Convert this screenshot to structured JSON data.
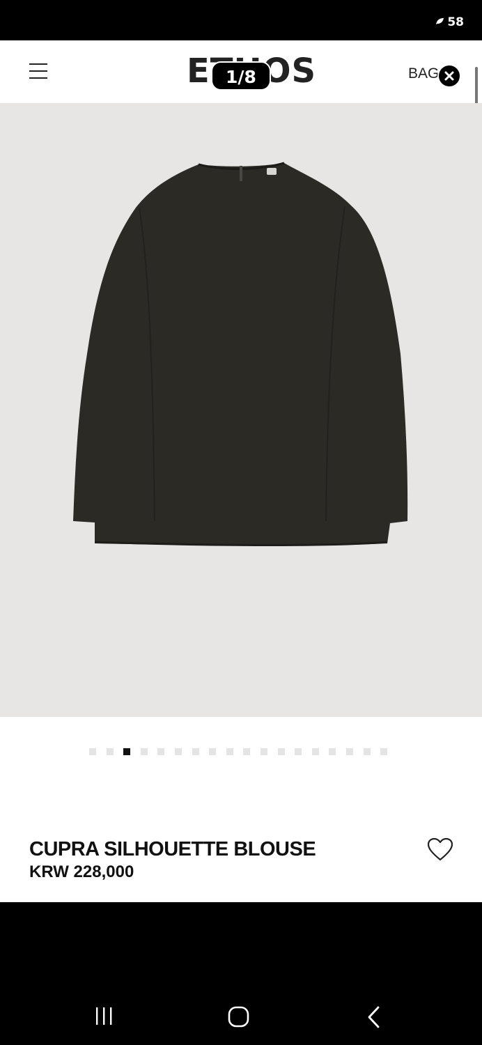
{
  "status_bar": {
    "battery": "58"
  },
  "header": {
    "logo": "ETHOS",
    "image_counter": "1/8",
    "bag_label": "BAG("
  },
  "gallery": {
    "total_dots": 18,
    "active_dot": 3
  },
  "product": {
    "name": "CUPRA SILHOUETTE BLOUSE",
    "price": "KRW 228,000"
  },
  "colors": {
    "image_background": "#e8e6e4",
    "garment": "#2c2a25"
  }
}
